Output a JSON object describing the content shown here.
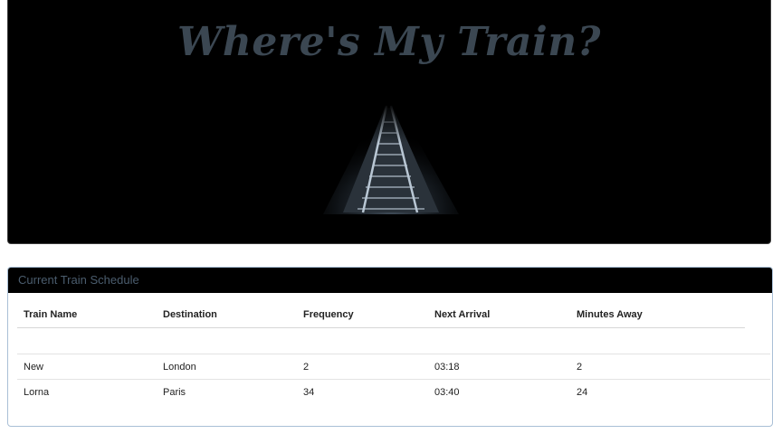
{
  "jumbotron": {
    "title": "Where's My Train?",
    "image": "railroad-tracks-at-night",
    "background_color": "#000000",
    "title_color": "#3b4752"
  },
  "schedule": {
    "heading": "Current Train Schedule",
    "columns": [
      "Train Name",
      "Destination",
      "Frequency",
      "Next Arrival",
      "Minutes Away"
    ],
    "rows": [
      {
        "name": "New",
        "destination": "London",
        "frequency": "2",
        "next_arrival": "03:18",
        "minutes_away": "2"
      },
      {
        "name": "Lorna",
        "destination": "Paris",
        "frequency": "34",
        "next_arrival": "03:40",
        "minutes_away": "24"
      }
    ]
  }
}
